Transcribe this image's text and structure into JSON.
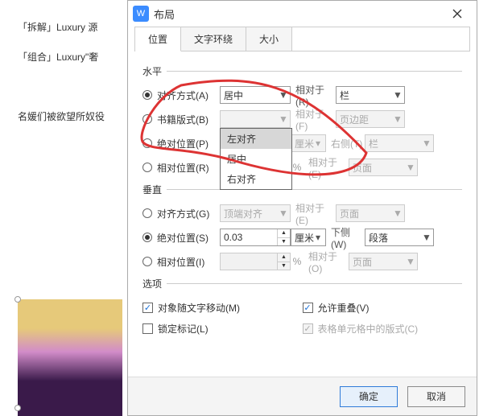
{
  "bg_text": {
    "line1": "「拆解」Luxury 源",
    "line2": "「组合」Luxury\"奢",
    "line3": "名媛们被欲望所奴役"
  },
  "dialog": {
    "title": "布局"
  },
  "tabs": [
    {
      "label": "位置"
    },
    {
      "label": "文字环绕"
    },
    {
      "label": "大小"
    }
  ],
  "horiz": {
    "title": "水平",
    "align": {
      "label": "对齐方式(A)",
      "value": "居中",
      "rel_label": "相对于(R)",
      "rel_value": "栏"
    },
    "book": {
      "label": "书籍版式(B)",
      "value": "",
      "rel_label": "相对于(F)",
      "rel_value": "页边距"
    },
    "abs": {
      "label": "绝对位置(P)",
      "value": "",
      "unit": "厘米",
      "side_label": "右侧(T)",
      "rel_value": "栏"
    },
    "rel": {
      "label": "相对位置(R)",
      "value": "",
      "pct": "%",
      "rel_label": "相对于(E)",
      "rel_value": "页面"
    },
    "dropdown": [
      "左对齐",
      "居中",
      "右对齐"
    ]
  },
  "vert": {
    "title": "垂直",
    "align": {
      "label": "对齐方式(G)",
      "value": "顶端对齐",
      "rel_label": "相对于(E)",
      "rel_value": "页面"
    },
    "abs": {
      "label": "绝对位置(S)",
      "value": "0.03",
      "unit": "厘米",
      "side_label": "下侧(W)",
      "rel_value": "段落"
    },
    "rel": {
      "label": "相对位置(I)",
      "value": "",
      "pct": "%",
      "rel_label": "相对于(O)",
      "rel_value": "页面"
    }
  },
  "options": {
    "title": "选项",
    "move": "对象随文字移动(M)",
    "overlap": "允许重叠(V)",
    "lock": "锁定标记(L)",
    "tablecell": "表格单元格中的版式(C)"
  },
  "buttons": {
    "ok": "确定",
    "cancel": "取消"
  }
}
